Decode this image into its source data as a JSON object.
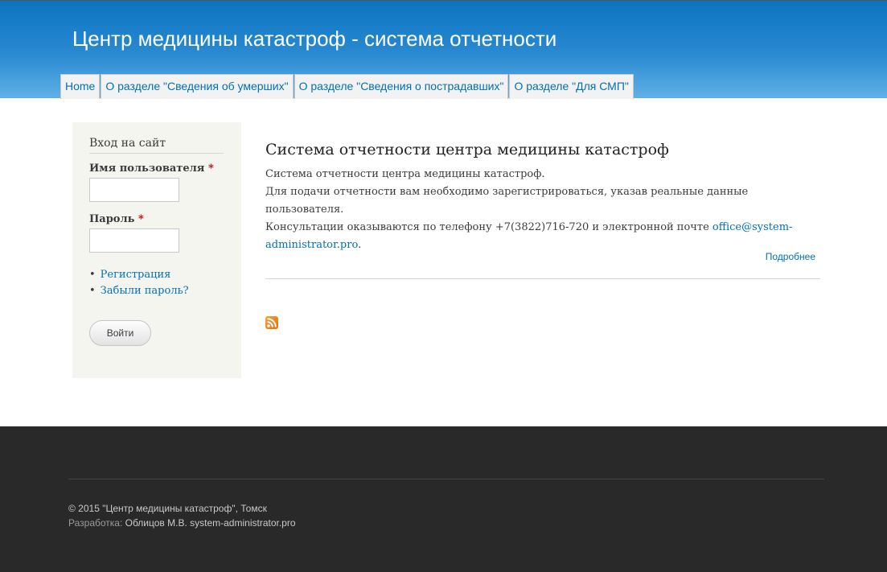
{
  "header": {
    "site_title": "Центр медицины катастроф - система отчетности",
    "menu": [
      "Home",
      "О разделе \"Сведения об умерших\"",
      "О разделе \"Сведения о пострадавших\"",
      "О разделе \"Для СМП\""
    ]
  },
  "login": {
    "title": "Вход на сайт",
    "username_label": "Имя пользователя",
    "password_label": "Пароль",
    "required_mark": "*",
    "username_value": "",
    "password_value": "",
    "links": [
      "Регистрация",
      "Забыли пароль?"
    ],
    "submit": "Войти"
  },
  "article": {
    "title": "Система отчетности центра медицины катастроф",
    "line1": "Система отчетности центра медицины катастроф.",
    "line2": "Для подачи отчетности вам необходимо зарегистрироваться, указав реальные данные пользователя.",
    "line3_prefix": "Консультации оказываются по телефону +7(3822)716-720 и электронной почте ",
    "email": "office@system-administrator.pro",
    "line3_suffix": ".",
    "read_more": "Подробнее"
  },
  "feed": {
    "icon": "rss-icon"
  },
  "footer": {
    "copyright": "© 2015 \"Центр медицины катастроф\", Томск",
    "dev_label": "Разработка:",
    "dev_value": "Облицов М.В. system-administrator.pro"
  },
  "colors": {
    "header_top": "#0b73c0",
    "header_bottom": "#5fb0e6",
    "link": "#0071b3",
    "footer_bg": "#292929",
    "sidebar_bg": "#f5f5f0"
  }
}
